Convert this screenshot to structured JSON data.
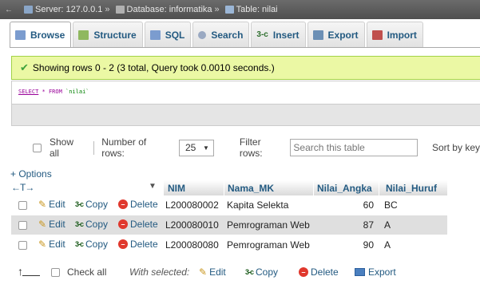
{
  "breadcrumb": {
    "server": "Server: 127.0.0.1",
    "database": "Database: informatika",
    "table": "Table: nilai",
    "separator": "»"
  },
  "tabs": [
    {
      "label": "Browse",
      "icon": "browse-icon",
      "color": "#7b9ccf"
    },
    {
      "label": "Structure",
      "icon": "structure-icon",
      "color": "#8fb85f"
    },
    {
      "label": "SQL",
      "icon": "sql-icon",
      "color": "#7b9ccf"
    },
    {
      "label": "Search",
      "icon": "search-icon",
      "color": "#9aa9c2"
    },
    {
      "label": "Insert",
      "icon": "insert-icon",
      "color": "#2d6e2d"
    },
    {
      "label": "Export",
      "icon": "export-icon",
      "color": "#6b8fb5"
    },
    {
      "label": "Import",
      "icon": "import-icon",
      "color": "#c0504d"
    }
  ],
  "message": "Showing rows 0 - 2 (3 total, Query took 0.0010 seconds.)",
  "sql": {
    "select": "SELECT",
    "rest": " * FROM ",
    "table": "`nilai`"
  },
  "nav": {
    "show_all": "Show all",
    "number_of_rows_label": "Number of rows:",
    "number_of_rows_value": "25",
    "filter_label": "Filter rows:",
    "filter_placeholder": "Search this table",
    "sort_label": "Sort by key"
  },
  "options": "+ Options",
  "columns": [
    "NIM",
    "Nama_MK",
    "Nilai_Angka",
    "Nilai_Huruf"
  ],
  "actions": {
    "edit": "Edit",
    "copy": "Copy",
    "delete": "Delete"
  },
  "rows": [
    {
      "nim": "L200080002",
      "nama_mk": "Kapita Selekta",
      "nilai_angka": "60",
      "nilai_huruf": "BC"
    },
    {
      "nim": "L200080010",
      "nama_mk": "Pemrograman Web",
      "nilai_angka": "87",
      "nilai_huruf": "A"
    },
    {
      "nim": "L200080080",
      "nama_mk": "Pemrograman Web",
      "nilai_angka": "90",
      "nilai_huruf": "A"
    }
  ],
  "bottom": {
    "check_all": "Check all",
    "with_selected": "With selected:",
    "edit": "Edit",
    "copy": "Copy",
    "delete": "Delete",
    "export": "Export"
  },
  "colors": {
    "link": "#235a81",
    "success_bg": "#ebf8a4",
    "row_alt": "#dfdfdf"
  }
}
